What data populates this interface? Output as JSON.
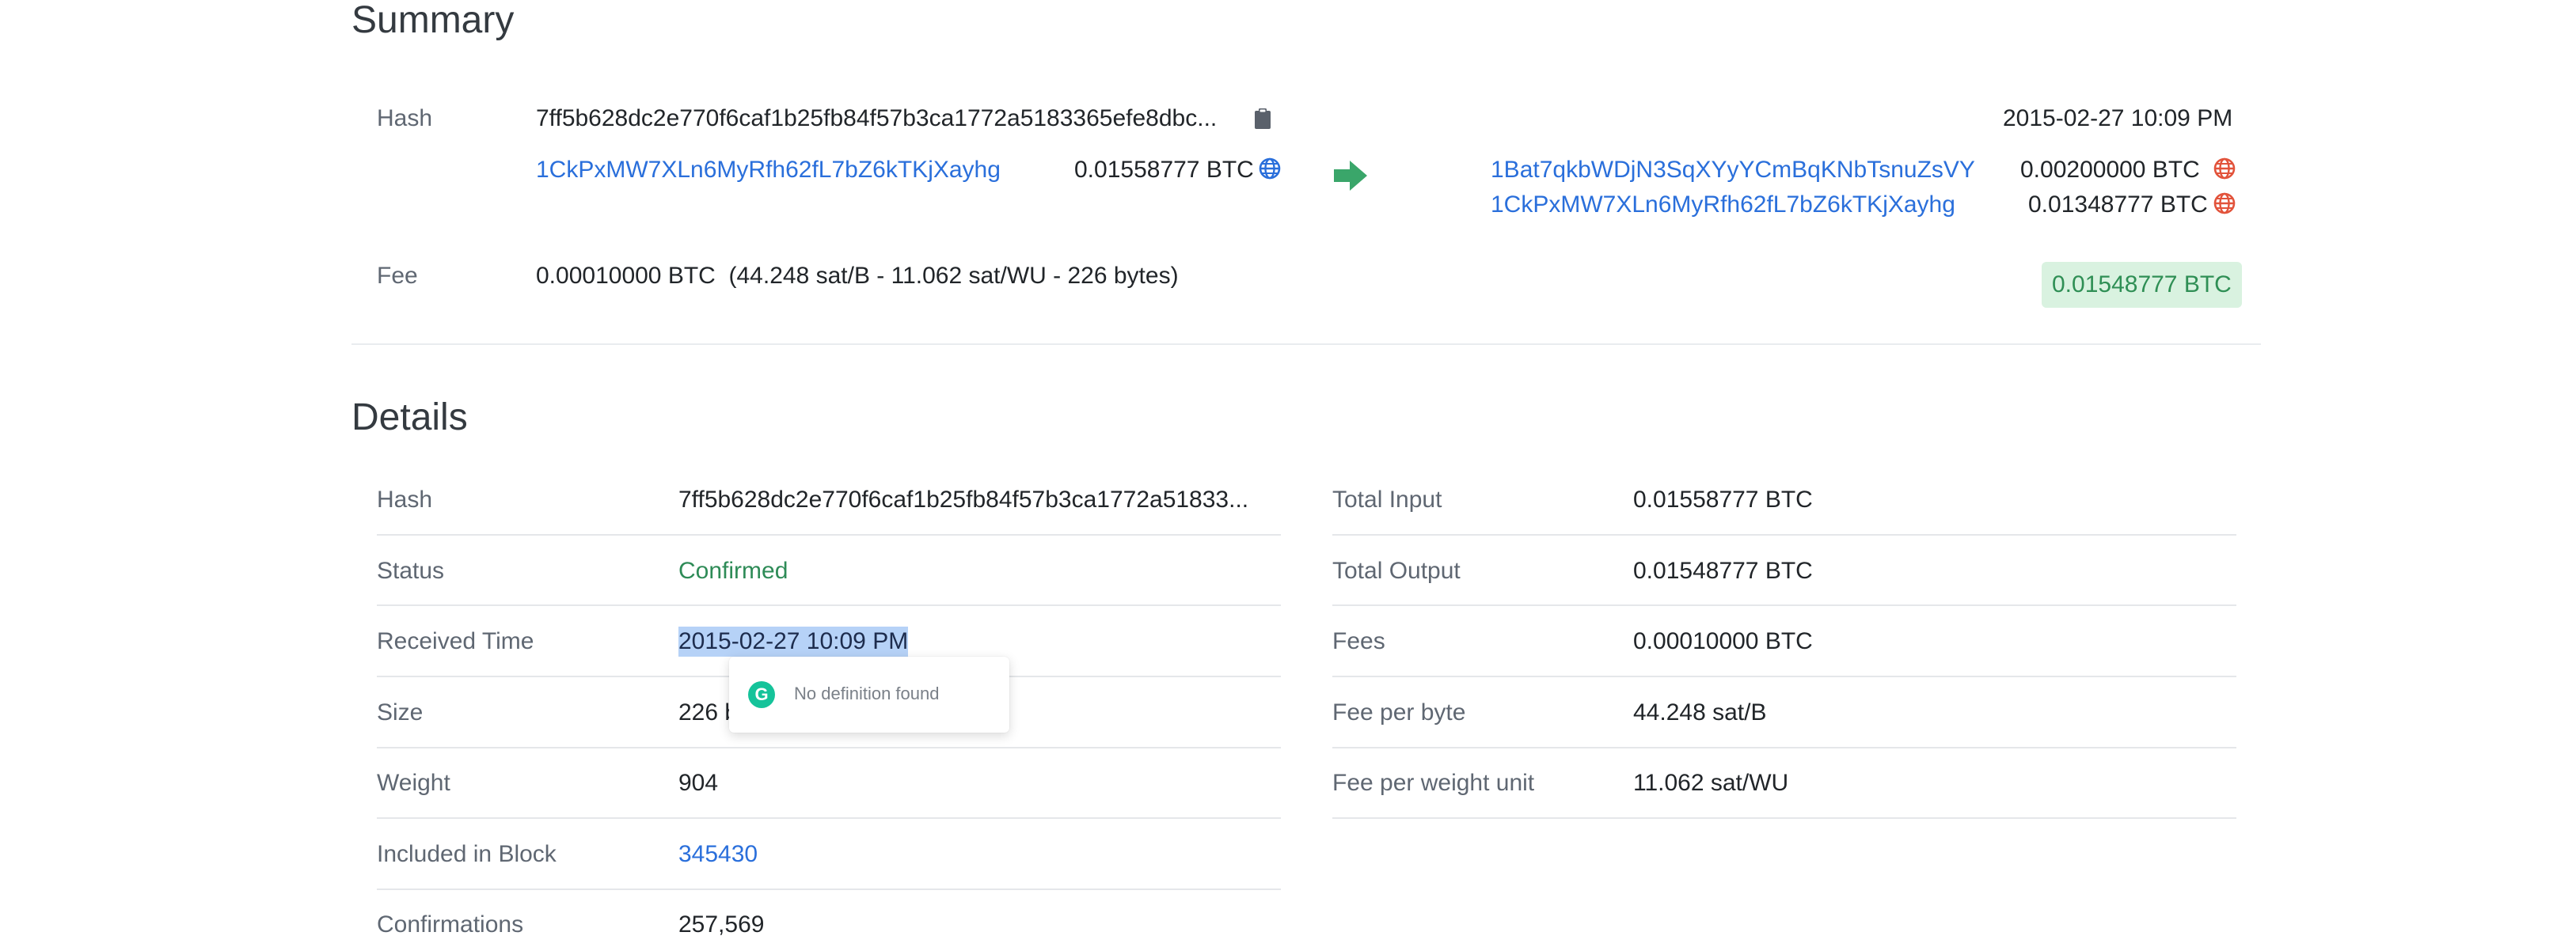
{
  "summary": {
    "heading": "Summary",
    "hash_label": "Hash",
    "hash_value": "7ff5b628dc2e770f6caf1b25fb84f57b3ca1772a5183365efe8dbc...",
    "time": "2015-02-27 10:09 PM",
    "input": {
      "address": "1CkPxMW7XLn6MyRfh62fL7bZ6kTKjXayhg",
      "amount": "0.01558777 BTC"
    },
    "outputs": [
      {
        "address": "1Bat7qkbWDjN3SqXYyYCmBqKNbTsnuZsVY",
        "amount": "0.00200000 BTC"
      },
      {
        "address": "1CkPxMW7XLn6MyRfh62fL7bZ6kTKjXayhg",
        "amount": "0.01348777 BTC"
      }
    ],
    "fee_label": "Fee",
    "fee_value": "0.00010000 BTC  (44.248 sat/B - 11.062 sat/WU - 226 bytes)",
    "total_out": "0.01548777 BTC"
  },
  "details": {
    "heading": "Details",
    "left": [
      {
        "label": "Hash",
        "value": "7ff5b628dc2e770f6caf1b25fb84f57b3ca1772a51833..."
      },
      {
        "label": "Status",
        "value": "Confirmed"
      },
      {
        "label": "Received Time",
        "value": "2015-02-27 10:09 PM"
      },
      {
        "label": "Size",
        "value": "226 b"
      },
      {
        "label": "Weight",
        "value": "904"
      },
      {
        "label": "Included in Block",
        "value": "345430"
      },
      {
        "label": "Confirmations",
        "value": "257,569"
      }
    ],
    "right": [
      {
        "label": "Total Input",
        "value": "0.01558777 BTC"
      },
      {
        "label": "Total Output",
        "value": "0.01548777 BTC"
      },
      {
        "label": "Fees",
        "value": "0.00010000 BTC"
      },
      {
        "label": "Fee per byte",
        "value": "44.248 sat/B"
      },
      {
        "label": "Fee per weight unit",
        "value": "11.062 sat/WU"
      }
    ]
  },
  "popup": {
    "text": "No definition found"
  },
  "colors": {
    "link": "#2a6fdb",
    "confirmed": "#2e8b57",
    "badge_bg": "#d9f2e0",
    "arrow": "#3aa66a",
    "globe_blue": "#2a6fdb",
    "globe_red": "#e2533b"
  },
  "icons": [
    "clipboard-icon",
    "globe-icon",
    "arrow-right-icon",
    "grammarly-icon"
  ]
}
